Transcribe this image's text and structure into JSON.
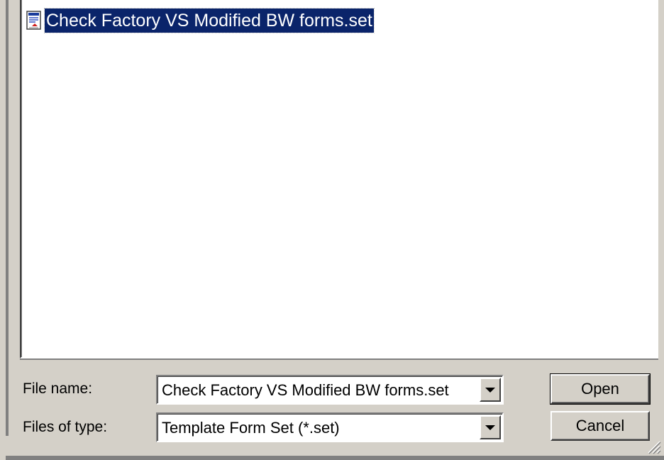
{
  "file_list": {
    "items": [
      {
        "name": "Check Factory VS Modified BW forms.set",
        "icon": "template-form-set-icon",
        "selected": true
      }
    ]
  },
  "file_name": {
    "label": "File name:",
    "value": "Check Factory VS Modified BW forms.set"
  },
  "file_type": {
    "label": "Files of type:",
    "value": "Template Form Set (*.set)"
  },
  "buttons": {
    "open": "Open",
    "cancel": "Cancel"
  },
  "colors": {
    "dialog_bg": "#d4d0c8",
    "selection_bg": "#0a246a",
    "selection_fg": "#ffffff"
  }
}
